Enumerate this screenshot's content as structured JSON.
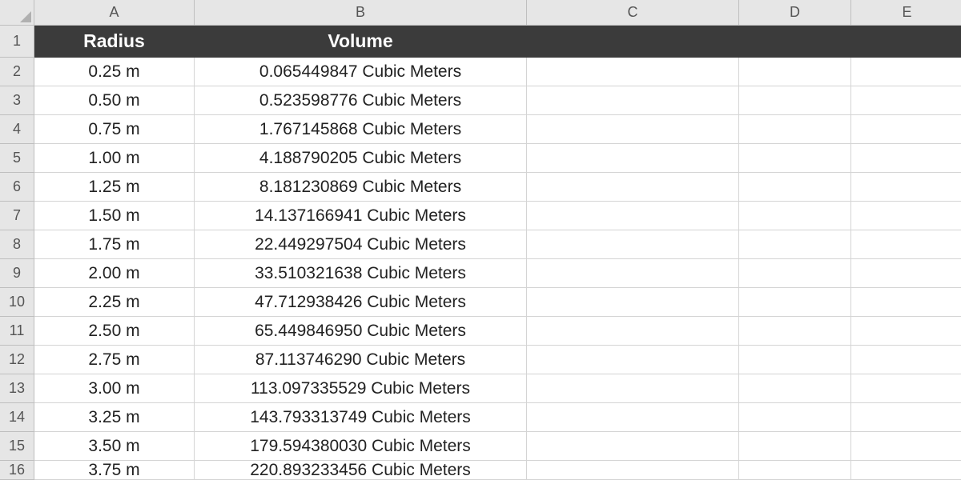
{
  "columns": [
    "A",
    "B",
    "C",
    "D",
    "E"
  ],
  "row_numbers": [
    1,
    2,
    3,
    4,
    5,
    6,
    7,
    8,
    9,
    10,
    11,
    12,
    13,
    14,
    15,
    16
  ],
  "headers": {
    "A": "Radius",
    "B": "Volume"
  },
  "rows": [
    {
      "radius": "0.25 m",
      "volume": "0.065449847 Cubic Meters"
    },
    {
      "radius": "0.50 m",
      "volume": "0.523598776 Cubic Meters"
    },
    {
      "radius": "0.75 m",
      "volume": "1.767145868 Cubic Meters"
    },
    {
      "radius": "1.00 m",
      "volume": "4.188790205 Cubic Meters"
    },
    {
      "radius": "1.25 m",
      "volume": "8.181230869 Cubic Meters"
    },
    {
      "radius": "1.50 m",
      "volume": "14.137166941 Cubic Meters"
    },
    {
      "radius": "1.75 m",
      "volume": "22.449297504 Cubic Meters"
    },
    {
      "radius": "2.00 m",
      "volume": "33.510321638 Cubic Meters"
    },
    {
      "radius": "2.25 m",
      "volume": "47.712938426 Cubic Meters"
    },
    {
      "radius": "2.50 m",
      "volume": "65.449846950 Cubic Meters"
    },
    {
      "radius": "2.75 m",
      "volume": "87.113746290 Cubic Meters"
    },
    {
      "radius": "3.00 m",
      "volume": "113.097335529 Cubic Meters"
    },
    {
      "radius": "3.25 m",
      "volume": "143.793313749 Cubic Meters"
    },
    {
      "radius": "3.50 m",
      "volume": "179.594380030 Cubic Meters"
    }
  ],
  "partial_row": {
    "radius": "3.75 m",
    "volume": "220.893233456 Cubic Meters"
  }
}
